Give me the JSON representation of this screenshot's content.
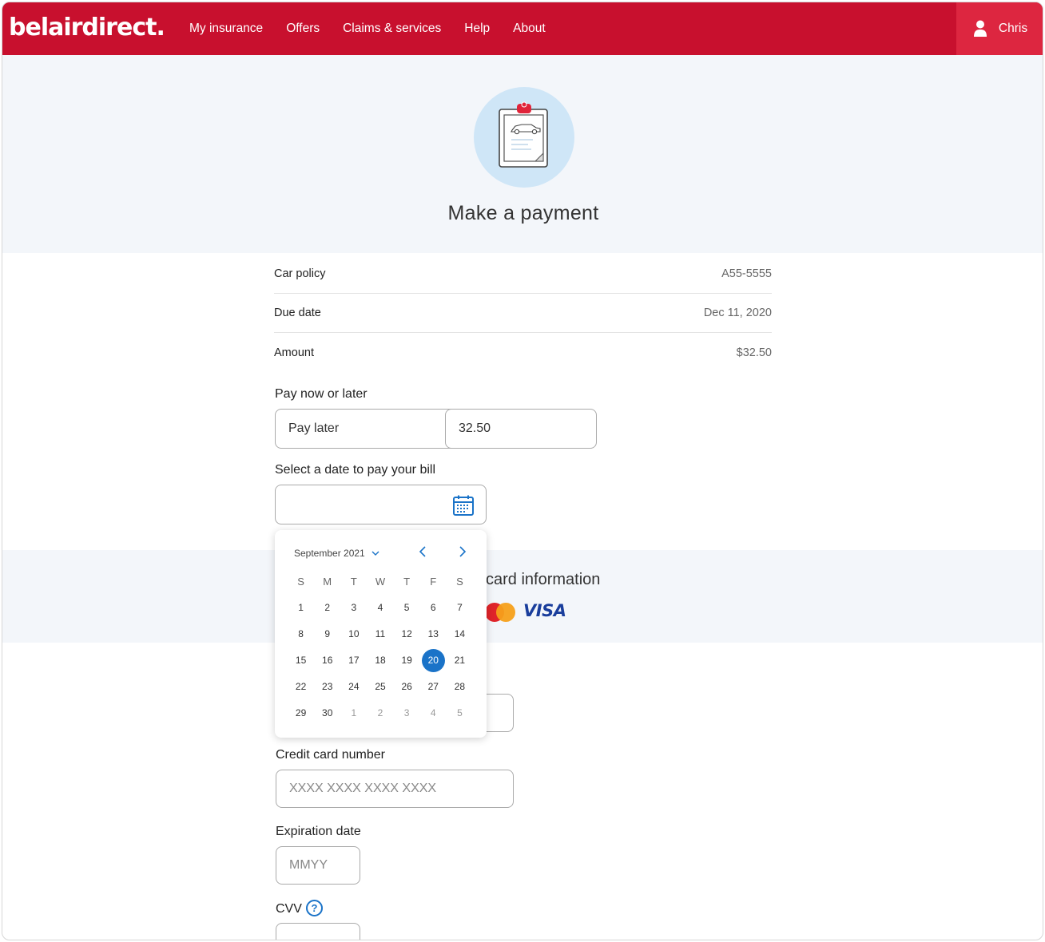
{
  "header": {
    "logo": "belairdirect.",
    "nav": [
      "My insurance",
      "Offers",
      "Claims & services",
      "Help",
      "About"
    ],
    "user": "Chris"
  },
  "hero": {
    "title": "Make a payment"
  },
  "summary": [
    {
      "label": "Car policy",
      "value": "A55-5555"
    },
    {
      "label": "Due date",
      "value": "Dec 11, 2020"
    },
    {
      "label": "Amount",
      "value": "$32.50"
    }
  ],
  "pay": {
    "label": "Pay now or later",
    "option": "Pay later",
    "amount": "32.50",
    "date_label": "Select a date to pay your bill"
  },
  "calendar": {
    "month": "September 2021",
    "weekdays": [
      "S",
      "M",
      "T",
      "W",
      "T",
      "F",
      "S"
    ],
    "weeks": [
      [
        "1",
        "2",
        "3",
        "4",
        "5",
        "6",
        "7"
      ],
      [
        "8",
        "9",
        "10",
        "11",
        "12",
        "13",
        "14"
      ],
      [
        "15",
        "16",
        "17",
        "18",
        "19",
        "20",
        "21"
      ],
      [
        "22",
        "23",
        "24",
        "25",
        "26",
        "27",
        "28"
      ],
      [
        "29",
        "30",
        "1",
        "2",
        "3",
        "4",
        "5"
      ]
    ],
    "selected": "20"
  },
  "card": {
    "title": "card information",
    "visa": "VISA",
    "cc_label": "Credit card number",
    "cc_placeholder": "XXXX XXXX XXXX XXXX",
    "exp_label": "Expiration date",
    "exp_placeholder": "MMYY",
    "cvv_label": "CVV",
    "help": "?"
  },
  "colors": {
    "brand": "#c8102e",
    "accent": "#1a73c8",
    "band": "#f3f6fa"
  }
}
